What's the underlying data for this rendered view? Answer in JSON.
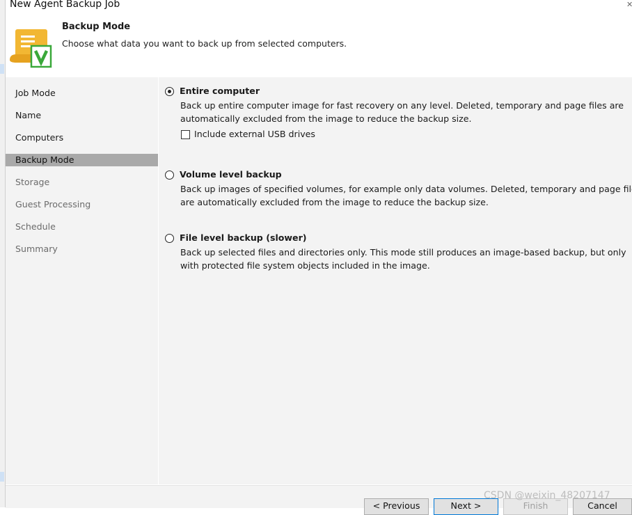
{
  "window": {
    "title": "New Agent Backup Job"
  },
  "header": {
    "title": "Backup Mode",
    "subtitle": "Choose what data you want to back up from selected computers.",
    "icon": "scroll-checkmark-icon",
    "icon_colors": {
      "scroll": "#f2b733",
      "check": "#3aa83a"
    }
  },
  "sidebar": {
    "items": [
      {
        "label": "Job Mode",
        "state": "done"
      },
      {
        "label": "Name",
        "state": "done"
      },
      {
        "label": "Computers",
        "state": "done"
      },
      {
        "label": "Backup Mode",
        "state": "active"
      },
      {
        "label": "Storage",
        "state": "pending"
      },
      {
        "label": "Guest Processing",
        "state": "pending"
      },
      {
        "label": "Schedule",
        "state": "pending"
      },
      {
        "label": "Summary",
        "state": "pending"
      }
    ]
  },
  "options": [
    {
      "title": "Entire computer",
      "selected": true,
      "description": [
        "Back up entire computer image for fast recovery on any level. Deleted, temporary and page files are",
        "automatically excluded from the image to reduce the backup size."
      ],
      "checkbox": {
        "label": "Include external USB drives",
        "checked": false
      }
    },
    {
      "title": "Volume level backup",
      "selected": false,
      "description": [
        "Back up images of specified volumes, for example only data volumes. Deleted, temporary and page files",
        "are automatically excluded from the image to reduce the backup size."
      ]
    },
    {
      "title": "File level backup (slower)",
      "selected": false,
      "description": [
        "Back up selected files and directories only. This mode still produces an image-based backup, but only",
        "with protected file system objects included in the image."
      ]
    }
  ],
  "buttons": {
    "previous": "< Previous",
    "next": "Next >",
    "finish": "Finish",
    "cancel": "Cancel"
  },
  "watermark": "CSDN @weixin_48207147"
}
